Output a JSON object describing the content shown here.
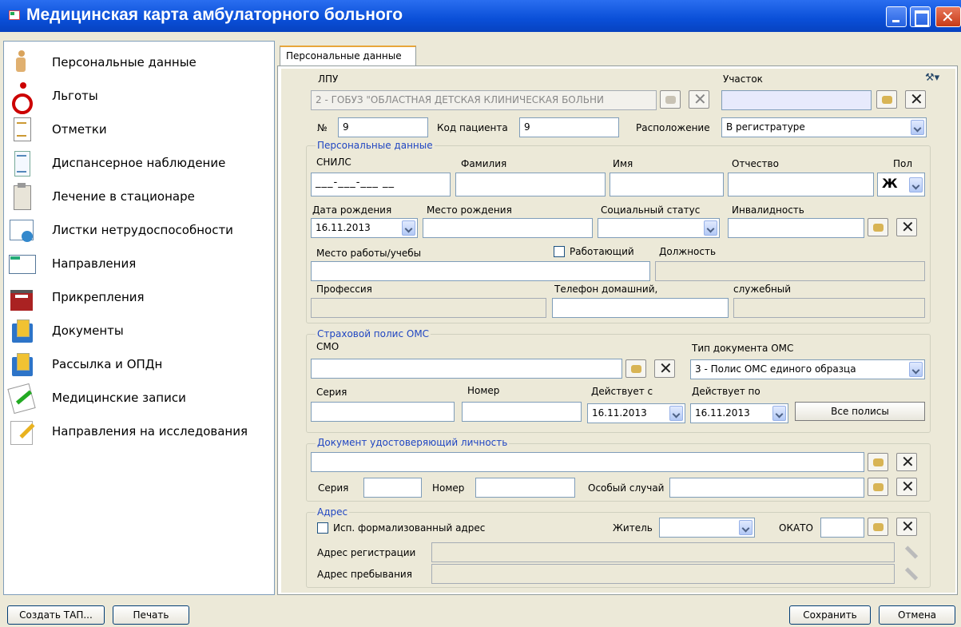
{
  "window": {
    "title": "Медицинская карта амбулаторного больного"
  },
  "sidebar": {
    "items": [
      {
        "label": "Персональные данные",
        "icon": "person-icon"
      },
      {
        "label": "Льготы",
        "icon": "wheelchair-icon"
      },
      {
        "label": "Отметки",
        "icon": "document-icon"
      },
      {
        "label": "Диспансерное наблюдение",
        "icon": "list-icon"
      },
      {
        "label": "Лечение в стационаре",
        "icon": "clipboard-icon"
      },
      {
        "label": "Листки нетрудоспособности",
        "icon": "sheet-icon"
      },
      {
        "label": "Направления",
        "icon": "envelope-icon"
      },
      {
        "label": "Прикрепления",
        "icon": "building-icon"
      },
      {
        "label": "Документы",
        "icon": "folder-icon"
      },
      {
        "label": "Рассылка и ОПДн",
        "icon": "folder-icon"
      },
      {
        "label": "Медицинские записи",
        "icon": "records-icon"
      },
      {
        "label": "Направления на исследования",
        "icon": "pencil-icon"
      }
    ]
  },
  "tab": {
    "label": "Персональные данные"
  },
  "form": {
    "lpu_label": "ЛПУ",
    "lpu_value": "2 - ГОБУЗ \"ОБЛАСТНАЯ ДЕТСКАЯ КЛИНИЧЕСКАЯ БОЛЬНИ",
    "uchastok_label": "Участок",
    "uchastok_value": "",
    "num_label": "№",
    "num_value": "9",
    "kod_label": "Код пациента",
    "kod_value": "9",
    "raspol_label": "Расположение",
    "raspol_value": "В регистратуре",
    "personal": {
      "title": "Персональные данные",
      "snils_label": "СНИЛС",
      "snils_value": "___-___-___ __",
      "familiya_label": "Фамилия",
      "imya_label": "Имя",
      "otchestvo_label": "Отчество",
      "pol_label": "Пол",
      "pol_value": "Ж",
      "dob_label": "Дата рождения",
      "dob_value": "16.11.2013",
      "birthplace_label": "Место рождения",
      "status_label": "Социальный статус",
      "invalid_label": "Инвалидность",
      "work_label": "Место работы/учебы",
      "working_label": "Работающий",
      "position_label": "Должность",
      "profession_label": "Профессия",
      "phone_home_label": "Телефон домашний,",
      "phone_work_label": "служебный"
    },
    "oms": {
      "title": "Страховой полис ОМС",
      "smo_label": "СМО",
      "doctype_label": "Тип документа ОМС",
      "doctype_value": "3 - Полис ОМС единого образца",
      "seria_label": "Серия",
      "nomer_label": "Номер",
      "from_label": "Действует с",
      "from_value": "16.11.2013",
      "to_label": "Действует по",
      "to_value": "16.11.2013",
      "all_button": "Все полисы"
    },
    "iddoc": {
      "title": "Документ удостоверяющий личность",
      "seria_label": "Серия",
      "nomer_label": "Номер",
      "special_label": "Особый случай"
    },
    "address": {
      "title": "Адрес",
      "formal_label": "Исп. формализованный адрес",
      "resident_label": "Житель",
      "okato_label": "ОКАТО",
      "reg_label": "Адрес регистрации",
      "stay_label": "Адрес пребывания"
    }
  },
  "buttons": {
    "create": "Создать ТАП...",
    "print": "Печать",
    "save": "Сохранить",
    "cancel": "Отмена"
  }
}
